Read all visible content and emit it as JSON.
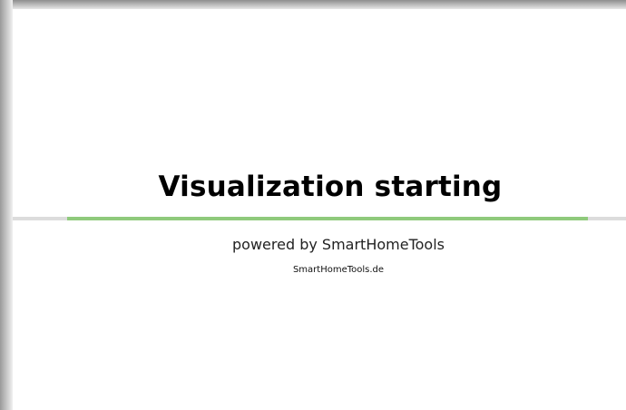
{
  "splash": {
    "title": "Visualization starting",
    "powered_by": "powered by SmartHomeTools",
    "link_text": "SmartHomeTools.de"
  },
  "progress": {
    "start_fraction": 0.089,
    "end_fraction": 0.938,
    "track_color": "#dcdcdc",
    "fill_color": "#8fca7c"
  }
}
